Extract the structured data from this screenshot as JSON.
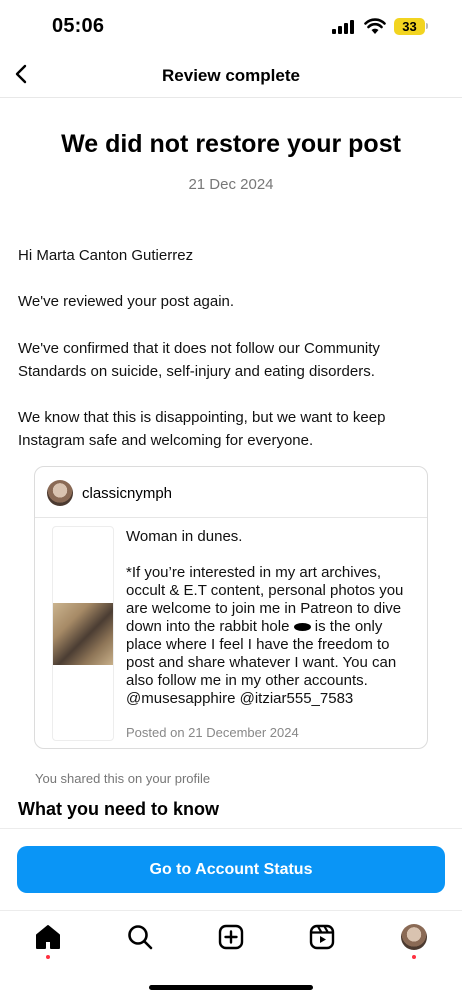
{
  "status_bar": {
    "time": "05:06",
    "battery": "33"
  },
  "header": {
    "title": "Review complete"
  },
  "headline": "We did not restore your post",
  "date": "21 Dec 2024",
  "paragraphs": [
    "Hi Marta Canton Gutierrez",
    "We've reviewed your post again.",
    "We've confirmed that it does not follow our Community Standards on suicide, self-injury and eating disorders.",
    "We know that this is disappointing, but we want to keep Instagram safe and welcoming for everyone."
  ],
  "post": {
    "username": "classicnymph",
    "caption_title": "Woman in dunes.",
    "caption_part1": "*If you’re interested in my art archives, occult & E.T content, personal photos you are welcome to join me in Patreon to dive down into the rabbit hole",
    "caption_part2": "is the only place where I feel I have the freedom to post and share whatever I want. You can also follow me in my other accounts. @musesapphire @itziar555_7583",
    "posted": "Posted on 21 December 2024"
  },
  "shared_note": "You shared this on your profile",
  "section_title": "What you need to know",
  "cta_label": "Go to Account Status",
  "tabs": [
    "home-icon",
    "search-icon",
    "create-icon",
    "reels-icon",
    "profile-avatar"
  ],
  "colors": {
    "accent": "#0a95f6",
    "notification_dot": "#ff3040",
    "battery": "#f2d420"
  }
}
